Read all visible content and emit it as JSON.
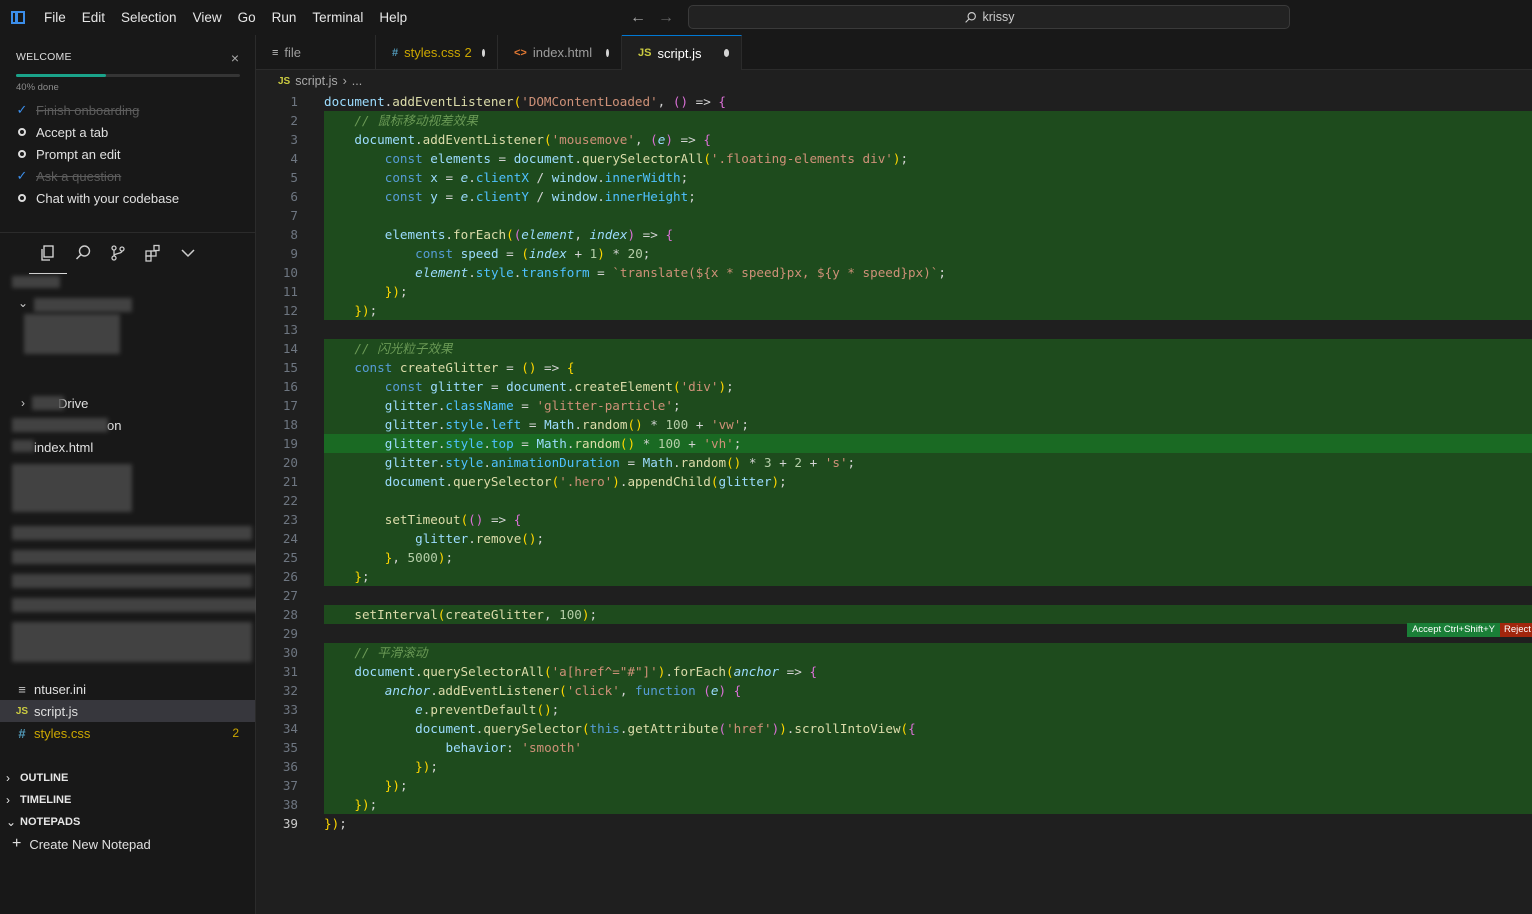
{
  "menu": [
    "File",
    "Edit",
    "Selection",
    "View",
    "Go",
    "Run",
    "Terminal",
    "Help"
  ],
  "search": {
    "text": "krissy"
  },
  "welcome": {
    "title": "WELCOME",
    "progress_text": "40% done",
    "progress": 0.4,
    "items": [
      {
        "label": "Finish onboarding",
        "done": true
      },
      {
        "label": "Accept a tab",
        "done": false
      },
      {
        "label": "Prompt an edit",
        "done": false
      },
      {
        "label": "Ask a question",
        "done": true
      },
      {
        "label": "Chat with your codebase",
        "done": false
      }
    ]
  },
  "explorer": {
    "partial_labels": {
      "onedrive": "Drive",
      "on": "on",
      "index_html": "index.html"
    },
    "files": [
      {
        "name": "ntuser.ini",
        "icon": "lines-icon"
      },
      {
        "name": "script.js",
        "icon": "js-icon",
        "selected": true
      },
      {
        "name": "styles.css",
        "icon": "css-icon",
        "badge": "2"
      }
    ]
  },
  "sections": {
    "outline": "OUTLINE",
    "timeline": "TIMELINE",
    "notepads": "NOTEPADS",
    "create_notepad": "Create New Notepad"
  },
  "tabs": [
    {
      "name": "file",
      "icon": "lines-icon"
    },
    {
      "name": "styles.css",
      "icon": "css-icon",
      "errors": "2",
      "dirty": true
    },
    {
      "name": "index.html",
      "icon": "html-icon",
      "dirty": true
    },
    {
      "name": "script.js",
      "icon": "js-icon",
      "dirty": true,
      "active": true
    }
  ],
  "breadcrumb": {
    "icon": "JS",
    "file": "script.js",
    "rest": "..."
  },
  "code_lines": [
    "document.addEventListener('DOMContentLoaded', () => {",
    "    // 鼠标移动视差效果",
    "    document.addEventListener('mousemove', (e) => {",
    "        const elements = document.querySelectorAll('.floating-elements div');",
    "        const x = e.clientX / window.innerWidth;",
    "        const y = e.clientY / window.innerHeight;",
    "",
    "        elements.forEach((element, index) => {",
    "            const speed = (index + 1) * 20;",
    "            element.style.transform = `translate(${x * speed}px, ${y * speed}px)`;",
    "        });",
    "    });",
    "",
    "    // 闪光粒子效果",
    "    const createGlitter = () => {",
    "        const glitter = document.createElement('div');",
    "        glitter.className = 'glitter-particle';",
    "        glitter.style.left = Math.random() * 100 + 'vw';",
    "        glitter.style.top = Math.random() * 100 + 'vh';",
    "        glitter.style.animationDuration = Math.random() * 3 + 2 + 's';",
    "        document.querySelector('.hero').appendChild(glitter);",
    "",
    "        setTimeout(() => {",
    "            glitter.remove();",
    "        }, 5000);",
    "    };",
    "",
    "    setInterval(createGlitter, 100);",
    "",
    "    // 平滑滚动",
    "    document.querySelectorAll('a[href^=\"#\"]').forEach(anchor => {",
    "        anchor.addEventListener('click', function (e) {",
    "            e.preventDefault();",
    "            document.querySelector(this.getAttribute('href')).scrollIntoView({",
    "                behavior: 'smooth'",
    "            });",
    "        });",
    "    });",
    "});"
  ],
  "current_line": 39,
  "inline_actions": {
    "accept": "Accept Ctrl+Shift+Y",
    "reject": "Reject"
  },
  "colors": {
    "accent": "#0078d4",
    "diff_green": "#1e4b1d",
    "progress": "#1aa38a"
  }
}
